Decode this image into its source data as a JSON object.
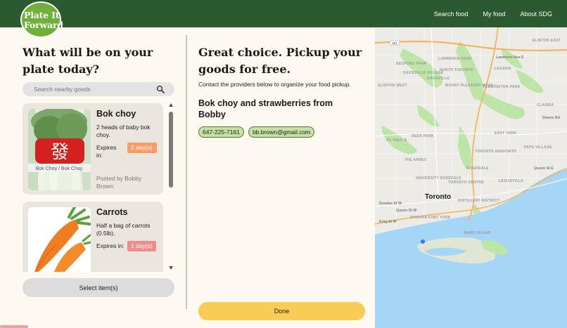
{
  "header": {
    "logo_text": "Plate It Forward",
    "nav": [
      "Search food",
      "My food",
      "About SDG"
    ]
  },
  "left": {
    "title": "What will be on your plate today?",
    "search_placeholder": "Search nearby goods",
    "items": [
      {
        "name": "Bok choy",
        "description": "2 heads of baby bok choy.",
        "expires_label": "Expires in:",
        "expires_value": "2 day(s)",
        "posted_by": "Posted by Bobby Brown",
        "image_labels": [
          "Bok Choy / Bok Chay",
          "發"
        ]
      },
      {
        "name": "Carrots",
        "description": "Half a bag of carrots (0.5lb).",
        "expires_label": "Expires in:",
        "expires_value": "1 day(s)"
      }
    ],
    "select_button": "Select item(s)"
  },
  "middle": {
    "title": "Great choice. Pickup your goods for free.",
    "subtitle": "Contact the providers below to organize your food pickup.",
    "provider_heading": "Bok choy and strawberries from Bobby",
    "phone": "647-225-7161",
    "email": "bb.brown@gmail.com",
    "done_button": "Done"
  },
  "map": {
    "city": "Toronto",
    "labels": [
      "Lawrence Ave E",
      "BEDFORD PARK",
      "LAWRENCE PARK",
      "NORTH TORONTO",
      "DAVISVILLE",
      "DAVISVILLE VILLAGE",
      "MOUNT PLEASANT WEST",
      "LEASIDE",
      "FLEMINGTON PARK",
      "CLAIREA",
      "EAST YORK",
      "ST. PAUL'S",
      "DEER PARK",
      "TORONTO DANFORTH",
      "PAPE VILLAGE",
      "THE ANNEX",
      "RIVERDALE",
      "LESLIEVILLE",
      "UNIVERSITY ROSEDALE",
      "TORONTO CENTRE",
      "DISTILLERY DISTRICT",
      "Dundas St W",
      "Queen St W",
      "SPADINA FORT YORK",
      "King St W",
      "Queen St E",
      "WARD ISLAND",
      "Dawes Rd",
      "ELINTON EAST",
      "GLINTON WEST"
    ],
    "route_badge": "401",
    "colors": {
      "water": "#a6d6f5",
      "park": "#bde5a8",
      "road": "#f3b561"
    }
  }
}
